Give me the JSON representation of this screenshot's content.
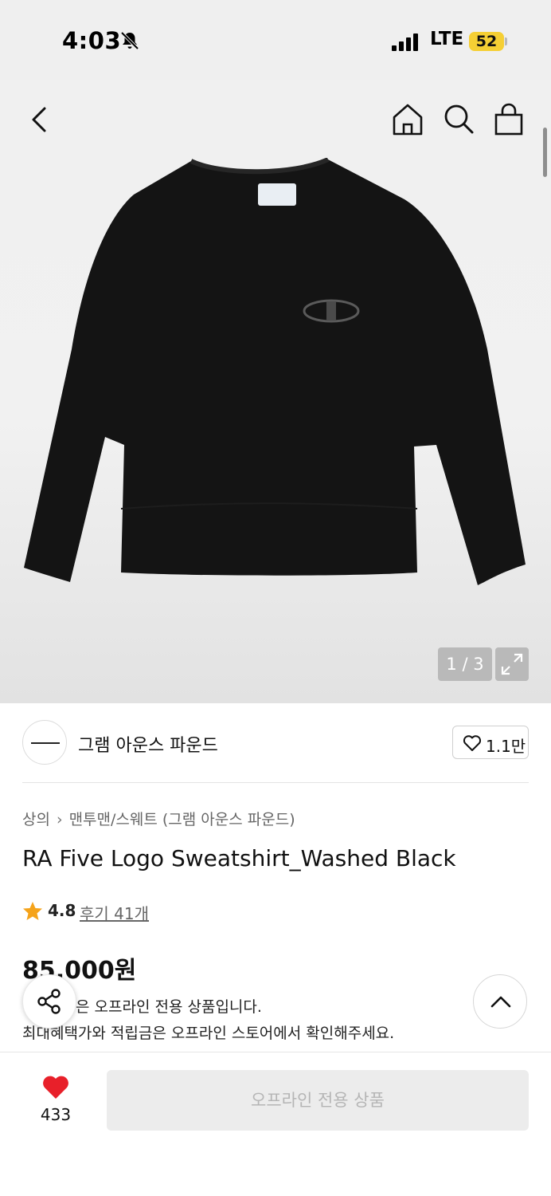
{
  "status_bar": {
    "time": "4:03",
    "network": "LTE",
    "battery": "52"
  },
  "hero": {
    "image_counter": "1 / 3"
  },
  "brand": {
    "name": "그램 아운스 파운드",
    "likes": "1.1만"
  },
  "product": {
    "breadcrumb": [
      "상의",
      "맨투맨/스웨트 (그램 아운스 파운드)"
    ],
    "title": "RA Five Logo Sweatshirt_Washed Black",
    "rating": "4.8",
    "reviews": "후기 41개",
    "price": "85,000원",
    "notice_line1": "은 오프라인 전용 상품입니다.",
    "notice_line2": "최대혜택가와 적립금은 오프라인 스토어에서 확인해주세요."
  },
  "bottom_bar": {
    "wish_count": "433",
    "action_label": "오프라인 전용 상품"
  },
  "icons": {
    "back": "chevron-left-icon",
    "home": "home-icon",
    "search": "search-icon",
    "cart": "bag-icon",
    "expand": "expand-icon",
    "heart": "heart-icon",
    "star": "star-icon",
    "share": "share-icon",
    "scroll_top": "chevron-up-icon"
  },
  "colors": {
    "battery": "#f5cf34",
    "star": "#f5a31a",
    "wish_heart": "#e8202a",
    "disabled_text": "#b5b5b5"
  }
}
